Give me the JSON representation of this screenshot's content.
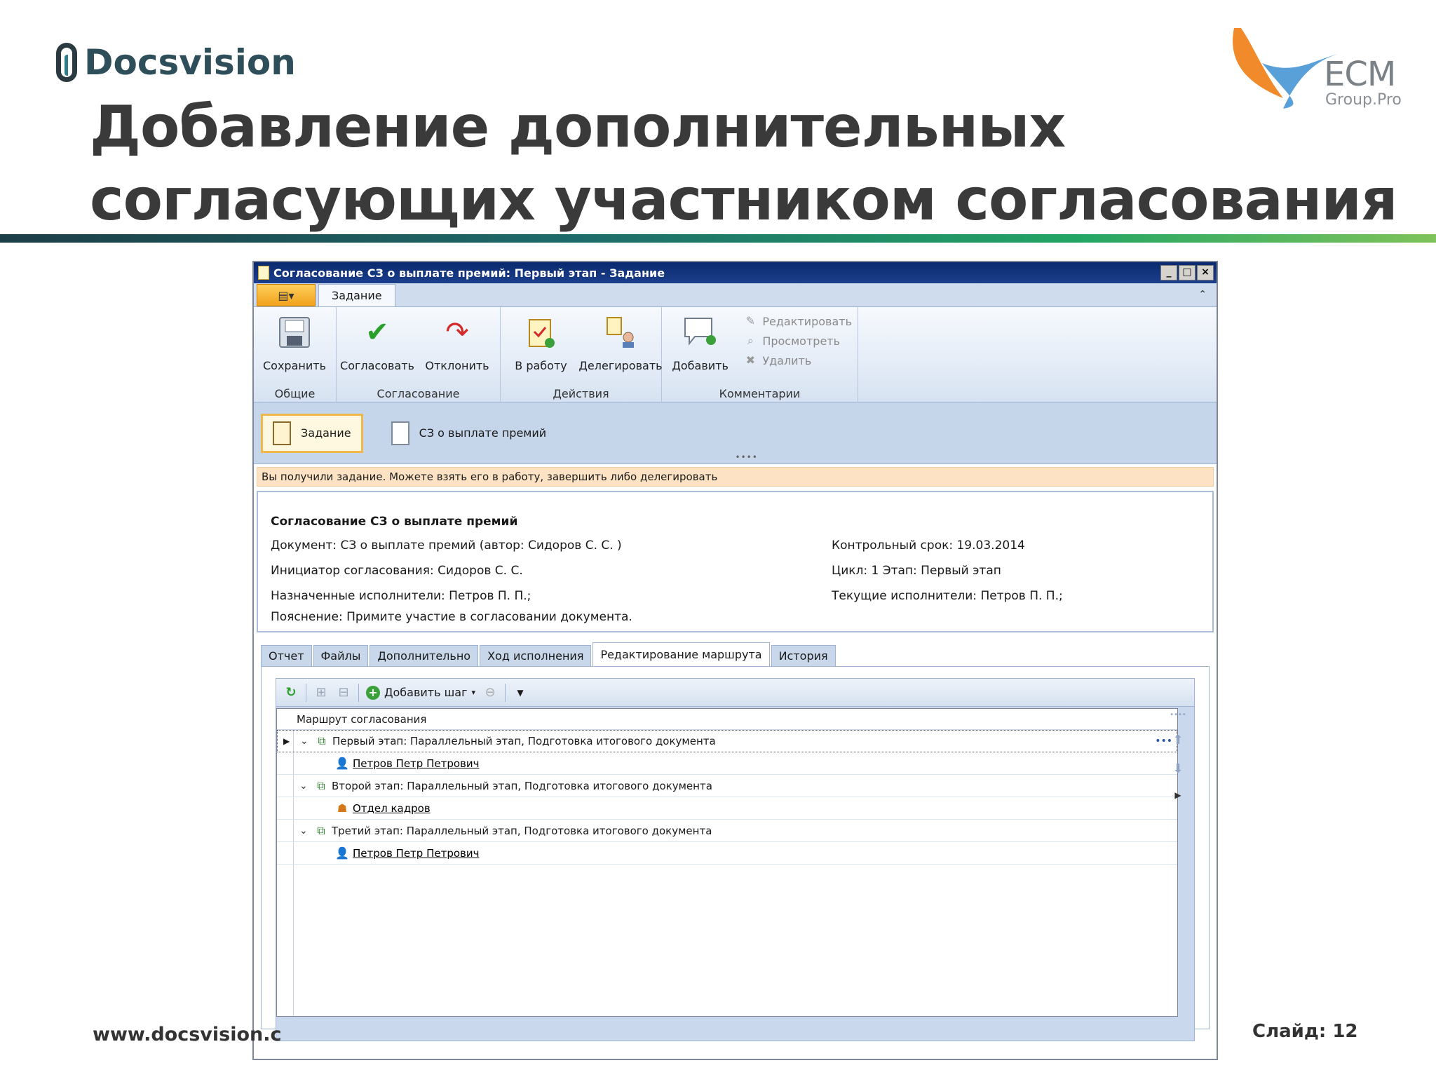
{
  "slide": {
    "brand": "Docsvision",
    "partner_brand": "ECM",
    "partner_sub": "Group.Pro",
    "title_line1": "Добавление дополнительных",
    "title_line2": "согласующих участником согласования",
    "footer_url": "www.docsvision.c",
    "slide_number": "Слайд: 12",
    "colors": {
      "title_bar_start": "#1c3d47",
      "title_bar_end": "#7fc35a",
      "brand": "#2e4e59"
    }
  },
  "window": {
    "title": "Согласование СЗ о выплате премий: Первый этап - Задание",
    "ribbon_tab": "Задание",
    "groups": [
      {
        "label": "Общие",
        "buttons": [
          {
            "label": "Сохранить",
            "icon": "save-icon"
          }
        ]
      },
      {
        "label": "Согласование",
        "buttons": [
          {
            "label": "Согласовать",
            "icon": "checkmark-icon"
          },
          {
            "label": "Отклонить",
            "icon": "redo-arrow-icon"
          }
        ]
      },
      {
        "label": "Действия",
        "buttons": [
          {
            "label": "В работу",
            "icon": "clipboard-add-icon"
          },
          {
            "label": "Делегировать",
            "icon": "delegate-icon"
          }
        ]
      },
      {
        "label": "Комментарии",
        "buttons": [
          {
            "label": "Добавить",
            "icon": "comment-add-icon"
          }
        ],
        "small_buttons": [
          {
            "label": "Редактировать",
            "icon": "edit-icon"
          },
          {
            "label": "Просмотреть",
            "icon": "view-icon"
          },
          {
            "label": "Удалить",
            "icon": "delete-icon"
          }
        ]
      }
    ],
    "doc_tabs": [
      "Задание",
      "СЗ о выплате премий"
    ],
    "notice": "Вы получили задание. Можете взять его в работу, завершить либо делегировать",
    "info": {
      "title": "Согласование СЗ о выплате премий",
      "document": "Документ: СЗ о выплате премий (автор: Сидоров С. С. )",
      "deadline": "Контрольный срок: 19.03.2014",
      "initiator": "Инициатор согласования: Сидоров С. С.",
      "cycle": "Цикл: 1 Этап: Первый этап",
      "assigned": "Назначенные исполнители: Петров П. П.;",
      "current": "Текущие исполнители: Петров П. П.;",
      "note": "Пояснение: Примите участие в согласовании документа."
    },
    "main_tabs": [
      "Отчет",
      "Файлы",
      "Дополнительно",
      "Ход исполнения",
      "Редактирование маршрута",
      "История"
    ],
    "active_main_tab": "Редактирование маршрута",
    "toolbar_add": "Добавить шаг",
    "tree_header": "Маршрут согласования",
    "stages": [
      {
        "label": "Первый этап: Параллельный этап, Подготовка итогового документа",
        "member": "Петров Петр Петрович",
        "member_icon": "person-icon"
      },
      {
        "label": "Второй этап: Параллельный этап, Подготовка итогового документа",
        "member": "Отдел кадров",
        "member_icon": "department-icon"
      },
      {
        "label": "Третий этап: Параллельный этап, Подготовка итогового документа",
        "member": "Петров Петр Петрович",
        "member_icon": "person-icon"
      }
    ]
  }
}
